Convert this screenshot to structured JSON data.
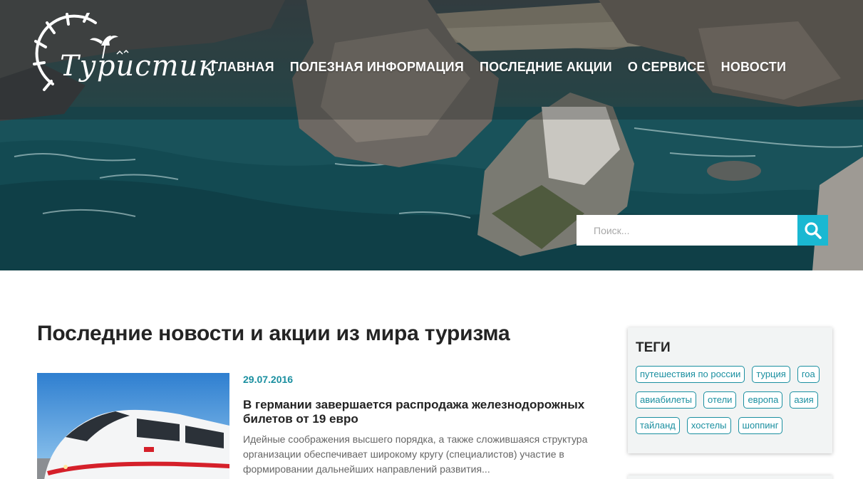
{
  "brand": {
    "logo_text": "Туристик"
  },
  "nav": {
    "items": [
      {
        "label": "ГЛАВНАЯ"
      },
      {
        "label": "ПОЛЕЗНАЯ ИНФОРМАЦИЯ"
      },
      {
        "label": "ПОСЛЕДНИЕ АКЦИИ"
      },
      {
        "label": "О СЕРВИСЕ"
      },
      {
        "label": "НОВОСТИ"
      }
    ]
  },
  "search": {
    "placeholder": "Поиск...",
    "icon": "search-icon"
  },
  "main": {
    "title": "Последние новости и акции из мира туризма",
    "articles": [
      {
        "date": "29.07.2016",
        "headline": "В германии завершается распродажа железнодорожных билетов от 19 евро",
        "excerpt": "Идейные соображения высшего порядка, а также сложившаяся структура организации обеспечивает широкому кругу (специалистов) участие в формировании дальнейших направлений развития..."
      }
    ]
  },
  "sidebar": {
    "tags_title": "ТЕГИ",
    "tags": [
      "путешествия по россии",
      "турция",
      "гоа",
      "авиабилеты",
      "отели",
      "европа",
      "азия",
      "тайланд",
      "хостелы",
      "шоппинг"
    ]
  },
  "colors": {
    "accent": "#1ab8d2",
    "tag": "#1a8fa0",
    "title": "#242424"
  }
}
